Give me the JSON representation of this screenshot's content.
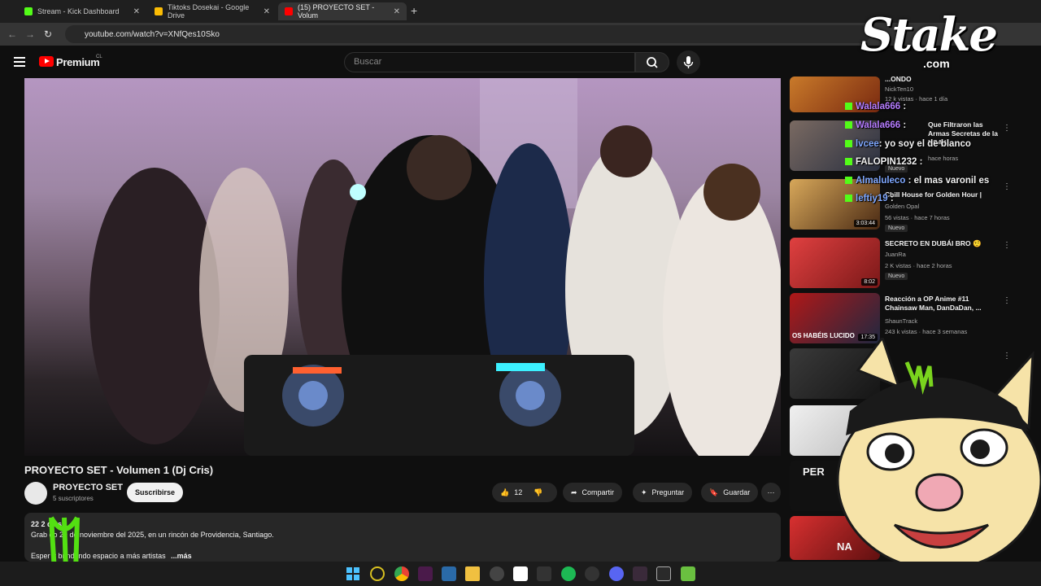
{
  "browser": {
    "tabs": [
      {
        "title": "Stream - Kick Dashboard",
        "active": false,
        "fav_color": "#53fc18"
      },
      {
        "title": "Tiktoks Dosekai - Google Drive",
        "active": false,
        "fav_color": "#fbbc04"
      },
      {
        "title": "(15) PROYECTO SET - Volum",
        "active": true,
        "fav_color": "#ff0000"
      }
    ],
    "new_tab": "+",
    "url": "youtube.com/watch?v=XNfQes10Sko"
  },
  "youtube": {
    "brand": "Premium",
    "region": "CL",
    "search_placeholder": "Buscar"
  },
  "video": {
    "title": "PROYECTO SET - Volumen 1 (Dj Cris)",
    "channel": "PROYECTO SET",
    "subscribers": "5 suscriptores",
    "subscribe_label": "Suscribirse",
    "likes": "12",
    "share_label": "Compartir",
    "ask_label": "Preguntar",
    "save_label": "Guardar",
    "description": {
      "line1": "22 2 días",
      "line2": "Grab do 29 de noviembre del 2025, en un rincón de Providencia, Santiago.",
      "line3": "Esper ir brindando espacio a más artistas",
      "more": "...más"
    }
  },
  "recommendations": [
    {
      "title": "...ONDO",
      "channel": "NickTen10",
      "meta": "12 k vistas · hace 1 día",
      "duration": "",
      "new": false
    },
    {
      "title": "Que Filtraron las Armas Secretas de la NSA |",
      "channel": "",
      "meta": "hace horas",
      "duration": "",
      "new": true
    },
    {
      "title": "Chill House for Golden Hour |",
      "channel": "Golden Opal",
      "meta": "56 vistas · hace 7 horas",
      "duration": "3:03:44",
      "new": true
    },
    {
      "title": "SECRETO EN DUBÁI BRO 🤨",
      "channel": "JuanRa",
      "meta": "2 K vistas · hace 2 horas",
      "duration": "8:02",
      "new": true
    },
    {
      "title": "Reacción a OP Anime #11 Chainsaw Man, DanDaDan, ...",
      "channel": "ShaunTrack",
      "meta": "243 k vistas · hace 3 semanas",
      "duration": "17:35",
      "new": false
    }
  ],
  "thumb_text": {
    "rec5": "OS HABÉIS LUCIDO",
    "rec7": "PER",
    "rec9": "NA"
  },
  "nuevo_label": "Nuevo",
  "chat": [
    {
      "user": "Walala666",
      "msg": ":",
      "color": "#b57cff"
    },
    {
      "user": "Walala666",
      "msg": ":",
      "color": "#b57cff"
    },
    {
      "user": "lvcee",
      "msg": ": yo soy el de blanco",
      "color": "#7fa8ff"
    },
    {
      "user": "FALOPIN1232",
      "msg": ":",
      "color": "#ffffff"
    },
    {
      "user": "Almaluleco",
      "msg": ": el mas varonil es",
      "color": "#7fa8ff"
    },
    {
      "user": "leftiy19",
      "msg": ":",
      "color": "#7fa8ff"
    }
  ],
  "overlay": {
    "sponsor": "Stake",
    "sponsor_domain": ".com"
  }
}
